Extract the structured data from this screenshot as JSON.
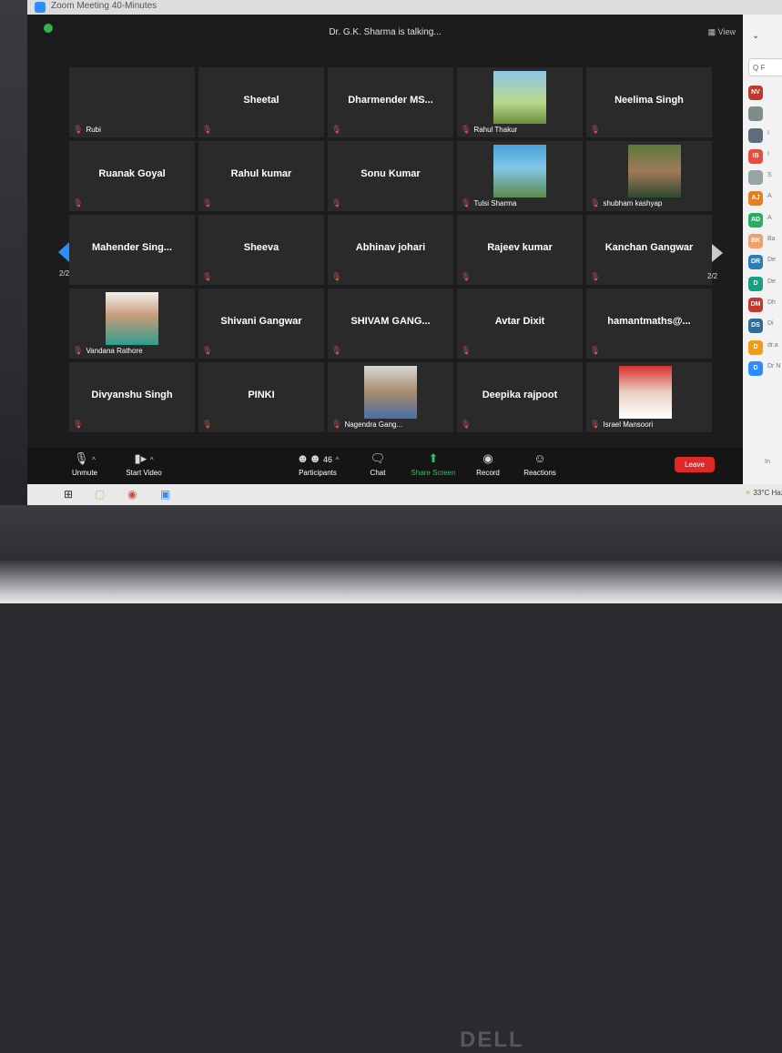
{
  "window": {
    "title": "Zoom Meeting 40-Minutes"
  },
  "topbar": {
    "speaking": "Dr. G.K. Sharma is talking...",
    "view_label": "View"
  },
  "grid": {
    "tiles": [
      {
        "name": "",
        "label": "Rubi"
      },
      {
        "name": "Sheetal",
        "label": ""
      },
      {
        "name": "Dharmender  MS...",
        "label": ""
      },
      {
        "name": "",
        "label": "Rahul Thakur"
      },
      {
        "name": "Neelima Singh",
        "label": ""
      },
      {
        "name": "Ruanak Goyal",
        "label": ""
      },
      {
        "name": "Rahul kumar",
        "label": ""
      },
      {
        "name": "Sonu Kumar",
        "label": ""
      },
      {
        "name": "",
        "label": "Tulsi Sharma"
      },
      {
        "name": "",
        "label": "shubham kashyap"
      },
      {
        "name": "Mahender  Sing...",
        "label": ""
      },
      {
        "name": "Sheeva",
        "label": ""
      },
      {
        "name": "Abhinav johari",
        "label": ""
      },
      {
        "name": "Rajeev kumar",
        "label": ""
      },
      {
        "name": "Kanchan Gangwar",
        "label": ""
      },
      {
        "name": "",
        "label": "Vandana Rathore"
      },
      {
        "name": "Shivani Gangwar",
        "label": ""
      },
      {
        "name": "SHIVAM  GANG...",
        "label": ""
      },
      {
        "name": "Avtar Dixit",
        "label": ""
      },
      {
        "name": "hamantmaths@...",
        "label": ""
      },
      {
        "name": "Divyanshu Singh",
        "label": ""
      },
      {
        "name": "PINKI",
        "label": ""
      },
      {
        "name": "",
        "label": "Nagendra Gang..."
      },
      {
        "name": "Deepika rajpoot",
        "label": ""
      },
      {
        "name": "",
        "label": "Israel Mansoori"
      }
    ]
  },
  "paging": {
    "left": "2/2",
    "right": "2/2"
  },
  "toolbar": {
    "unmute": "Unmute",
    "start_video": "Start Video",
    "participants": "Participants",
    "participants_count": "46",
    "chat": "Chat",
    "share_screen": "Share Screen",
    "record": "Record",
    "reactions": "Reactions",
    "leave": "Leave"
  },
  "sidebar": {
    "search_placeholder": "Q F",
    "participants": [
      {
        "initials": "NV",
        "color": "#c0392b",
        "name": ""
      },
      {
        "initials": "",
        "color": "#7f8c8d",
        "name": ""
      },
      {
        "initials": "",
        "color": "#5d6d7e",
        "name": "I"
      },
      {
        "initials": "IB",
        "color": "#e74c3c",
        "name": "I"
      },
      {
        "initials": "",
        "color": "#95a5a6",
        "name": "S"
      },
      {
        "initials": "AJ",
        "color": "#e67e22",
        "name": "A"
      },
      {
        "initials": "AD",
        "color": "#27ae60",
        "name": "A"
      },
      {
        "initials": "BK",
        "color": "#f0a06b",
        "name": "Ba"
      },
      {
        "initials": "DR",
        "color": "#2980b9",
        "name": "De"
      },
      {
        "initials": "D",
        "color": "#16a085",
        "name": "De"
      },
      {
        "initials": "DM",
        "color": "#c0392b",
        "name": "Dh"
      },
      {
        "initials": "DS",
        "color": "#2c6e9b",
        "name": "Di"
      },
      {
        "initials": "D",
        "color": "#f39c12",
        "name": "dr.a"
      },
      {
        "initials": "D",
        "color": "#2d8cff",
        "name": "Dr N"
      }
    ],
    "invite": "In"
  },
  "taskbar": {
    "weather": "33°C  Haz"
  },
  "laptop": {
    "brand": "DELL"
  }
}
